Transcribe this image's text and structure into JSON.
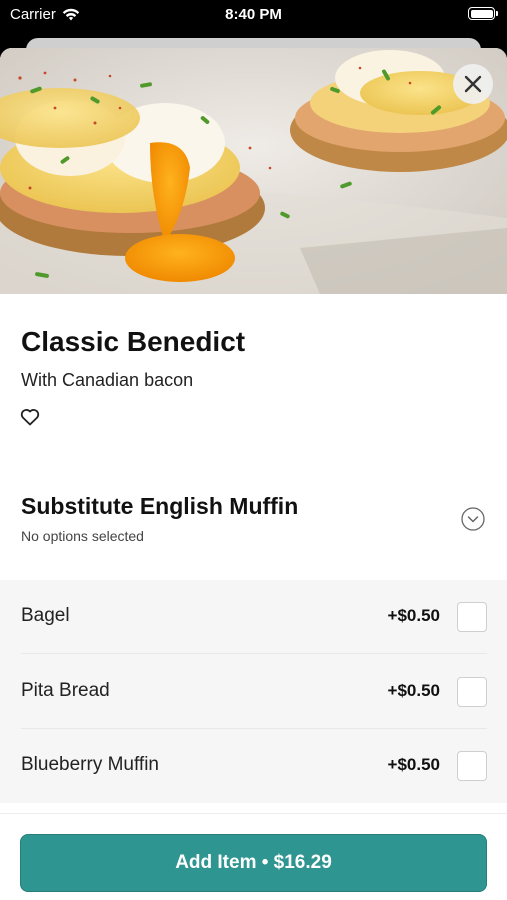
{
  "status_bar": {
    "carrier": "Carrier",
    "time": "8:40 PM"
  },
  "item": {
    "title": "Classic Benedict",
    "subtitle": "With Canadian bacon",
    "image_icon": "food-photo"
  },
  "section": {
    "title": "Substitute English Muffin",
    "subtitle": "No options selected"
  },
  "options": [
    {
      "name": "Bagel",
      "price": "+$0.50",
      "checked": false
    },
    {
      "name": "Pita Bread",
      "price": "+$0.50",
      "checked": false
    },
    {
      "name": "Blueberry Muffin",
      "price": "+$0.50",
      "checked": false
    }
  ],
  "footer": {
    "add_button_label": "Add Item • $16.29"
  },
  "colors": {
    "accent": "#2f9590",
    "background": "#ffffff",
    "options_background": "#f6f6f6"
  }
}
